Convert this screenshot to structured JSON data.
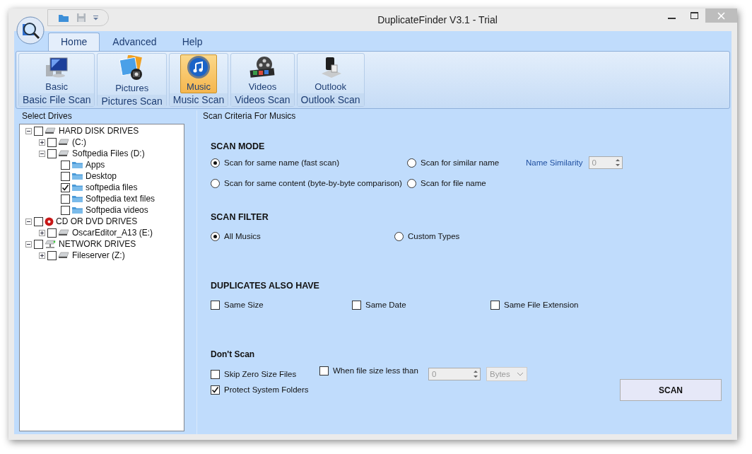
{
  "window": {
    "title": "DuplicateFinder V3.1 - Trial"
  },
  "tabs": [
    {
      "label": "Home",
      "selected": true
    },
    {
      "label": "Advanced",
      "selected": false
    },
    {
      "label": "Help",
      "selected": false
    }
  ],
  "ribbon": {
    "buttons": [
      {
        "label": "Basic",
        "group": "Basic File Scan",
        "kind": "basic",
        "selected": false
      },
      {
        "label": "Pictures",
        "group": "Pictures Scan",
        "kind": "pictures",
        "selected": false
      },
      {
        "label": "Music",
        "group": "Music Scan",
        "kind": "music",
        "selected": true
      },
      {
        "label": "Videos",
        "group": "Videos Scan",
        "kind": "videos",
        "selected": false
      },
      {
        "label": "Outlook",
        "group": "Outlook Scan",
        "kind": "outlook",
        "selected": false
      }
    ]
  },
  "drives": {
    "title": "Select Drives",
    "tree": [
      {
        "label": "HARD DISK DRIVES",
        "kind": "hdd",
        "checked": false,
        "expanded": true,
        "children": [
          {
            "label": "(C:)",
            "kind": "hdd",
            "checked": false,
            "expanded": false
          },
          {
            "label": "Softpedia Files (D:)",
            "kind": "hdd",
            "checked": false,
            "expanded": true,
            "children": [
              {
                "label": "Apps",
                "kind": "folder",
                "checked": false
              },
              {
                "label": "Desktop",
                "kind": "folder",
                "checked": false
              },
              {
                "label": "softpedia files",
                "kind": "folder",
                "checked": true
              },
              {
                "label": "Softpedia text files",
                "kind": "folder",
                "checked": false
              },
              {
                "label": "Softpedia videos",
                "kind": "folder",
                "checked": false
              }
            ]
          }
        ]
      },
      {
        "label": "CD OR DVD DRIVES",
        "kind": "cd",
        "checked": false,
        "expanded": true,
        "children": [
          {
            "label": "OscarEditor_A13 (E:)",
            "kind": "hdd",
            "checked": false,
            "expanded": false
          }
        ]
      },
      {
        "label": "NETWORK DRIVES",
        "kind": "network",
        "checked": false,
        "expanded": true,
        "children": [
          {
            "label": "Fileserver (Z:)",
            "kind": "hdd",
            "checked": false,
            "expanded": false
          }
        ]
      }
    ]
  },
  "criteria": {
    "title": "Scan Criteria For Musics",
    "scan_mode": {
      "title": "SCAN MODE",
      "options": [
        {
          "label": "Scan for same name (fast scan)",
          "selected": true
        },
        {
          "label": "Scan for similar name",
          "selected": false
        },
        {
          "label": "Scan for same content (byte-by-byte comparison)",
          "selected": false
        },
        {
          "label": "Scan for file name",
          "selected": false
        }
      ],
      "name_similarity": {
        "label": "Name Similarity",
        "value": "0",
        "disabled": true
      }
    },
    "scan_filter": {
      "title": "SCAN FILTER",
      "options": [
        {
          "label": "All Musics",
          "selected": true
        },
        {
          "label": "Custom Types",
          "selected": false
        }
      ]
    },
    "duplicates_also_have": {
      "title": "DUPLICATES ALSO HAVE",
      "options": [
        {
          "label": "Same Size",
          "checked": false
        },
        {
          "label": "Same Date",
          "checked": false
        },
        {
          "label": "Same File Extension",
          "checked": false
        }
      ]
    },
    "dont_scan": {
      "title": "Don't Scan",
      "skip_zero": {
        "label": "Skip Zero Size Files",
        "checked": false
      },
      "size_less": {
        "label": "When file size less than",
        "checked": false
      },
      "size_value": {
        "value": "0",
        "disabled": true
      },
      "size_unit": {
        "value": "Bytes",
        "disabled": true
      },
      "protect": {
        "label": "Protect System Folders",
        "checked": true
      }
    },
    "scan_button": "SCAN"
  }
}
